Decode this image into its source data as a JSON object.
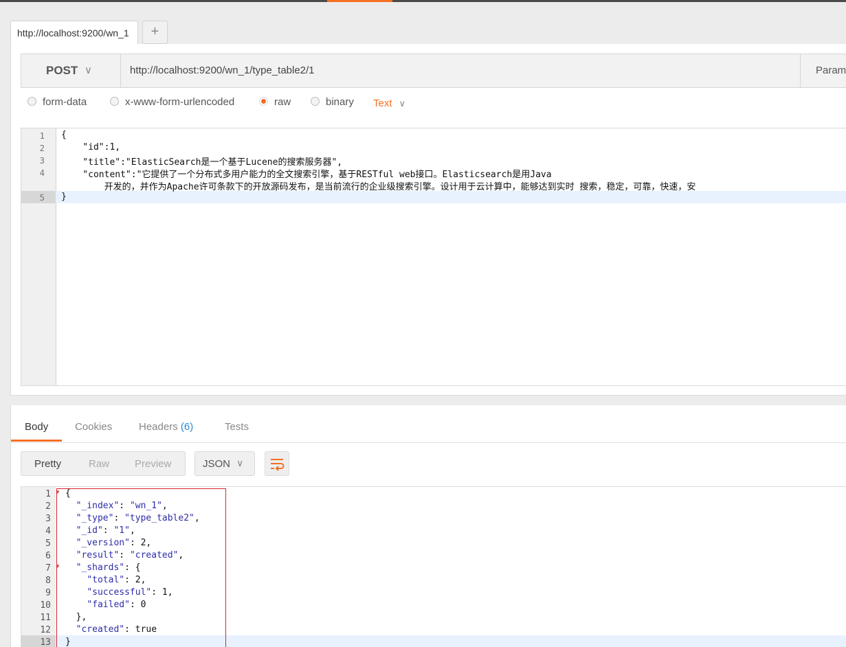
{
  "tabs": {
    "active": "http://localhost:9200/wn_1",
    "add_label": "+"
  },
  "request": {
    "method": "POST",
    "url": "http://localhost:9200/wn_1/type_table2/1",
    "params_label": "Params"
  },
  "body_options": {
    "form_data": "form-data",
    "urlencoded": "x-www-form-urlencoded",
    "raw": "raw",
    "binary": "binary",
    "selected": "raw",
    "content_type": "Text"
  },
  "request_body": {
    "line_numbers": [
      "1",
      "2",
      "3",
      "4",
      "5"
    ],
    "lines": [
      "{",
      "    \"id\":1,",
      "    \"title\":\"ElasticSearch是一个基于Lucene的搜索服务器\",",
      "    \"content\":\"它提供了一个分布式多用户能力的全文搜索引擎，基于RESTful web接口。Elasticsearch是用Java",
      "        开发的，并作为Apache许可条款下的开放源码发布，是当前流行的企业级搜索引擎。设计用于云计算中，能够达到实时 搜索，稳定，可靠，快速，安",
      "}"
    ]
  },
  "response_tabs": {
    "body": "Body",
    "cookies": "Cookies",
    "headers": "Headers",
    "headers_count": "(6)",
    "tests": "Tests"
  },
  "response_view": {
    "pretty": "Pretty",
    "raw": "Raw",
    "preview": "Preview",
    "format": "JSON"
  },
  "response_body": {
    "line_numbers": [
      "1",
      "2",
      "3",
      "4",
      "5",
      "6",
      "7",
      "8",
      "9",
      "10",
      "11",
      "12",
      "13"
    ],
    "lines": [
      {
        "indent": "",
        "key": "",
        "sep": "",
        "value": "",
        "text": "{"
      },
      {
        "indent": "  ",
        "key": "\"_index\"",
        "sep": ": ",
        "value": "\"wn_1\"",
        "tail": ","
      },
      {
        "indent": "  ",
        "key": "\"_type\"",
        "sep": ": ",
        "value": "\"type_table2\"",
        "tail": ","
      },
      {
        "indent": "  ",
        "key": "\"_id\"",
        "sep": ": ",
        "value": "\"1\"",
        "tail": ","
      },
      {
        "indent": "  ",
        "key": "\"_version\"",
        "sep": ": ",
        "value": "2",
        "tail": ","
      },
      {
        "indent": "  ",
        "key": "\"result\"",
        "sep": ": ",
        "value": "\"created\"",
        "tail": ","
      },
      {
        "indent": "  ",
        "key": "\"_shards\"",
        "sep": ": ",
        "value": "{",
        "tail": ""
      },
      {
        "indent": "    ",
        "key": "\"total\"",
        "sep": ": ",
        "value": "2",
        "tail": ","
      },
      {
        "indent": "    ",
        "key": "\"successful\"",
        "sep": ": ",
        "value": "1",
        "tail": ","
      },
      {
        "indent": "    ",
        "key": "\"failed\"",
        "sep": ": ",
        "value": "0",
        "tail": ""
      },
      {
        "indent": "  ",
        "key": "",
        "sep": "",
        "value": "",
        "text": "},"
      },
      {
        "indent": "  ",
        "key": "\"created\"",
        "sep": ": ",
        "value": "true",
        "tail": ""
      },
      {
        "indent": "",
        "key": "",
        "sep": "",
        "value": "",
        "text": "}"
      }
    ]
  },
  "colors": {
    "accent": "#f47023",
    "link": "#2b8ad1",
    "highlight_box": "#d9202e"
  }
}
